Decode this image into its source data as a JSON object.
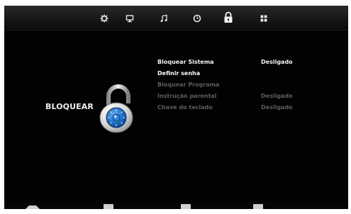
{
  "tabs": [
    {
      "icon": "gear-icon",
      "active": false
    },
    {
      "icon": "monitor-icon",
      "active": false
    },
    {
      "icon": "music-note-icon",
      "active": false
    },
    {
      "icon": "clock-icon",
      "active": false
    },
    {
      "icon": "padlock-icon",
      "active": true
    },
    {
      "icon": "grid-icon",
      "active": false
    }
  ],
  "section": {
    "title": "BLOQUEAR",
    "icon": "combination-lock-icon"
  },
  "menu": [
    {
      "label": "Bloquear Sistema",
      "value": "Desligado",
      "state": "active"
    },
    {
      "label": "Definir senha",
      "value": "",
      "state": "normal"
    },
    {
      "label": "Bloquear Programa",
      "value": "",
      "state": "disabled"
    },
    {
      "label": "Instrução parental",
      "value": "Desligado",
      "state": "disabled"
    },
    {
      "label": "Chave do teclado",
      "value": "Desligado",
      "state": "disabled"
    }
  ],
  "colors": {
    "background": "#020202",
    "topbar": "#1a1a1a",
    "active_text": "#f2f2f2",
    "disabled_text": "#5d5d5d",
    "lock_blue": "#1f6fc4"
  }
}
